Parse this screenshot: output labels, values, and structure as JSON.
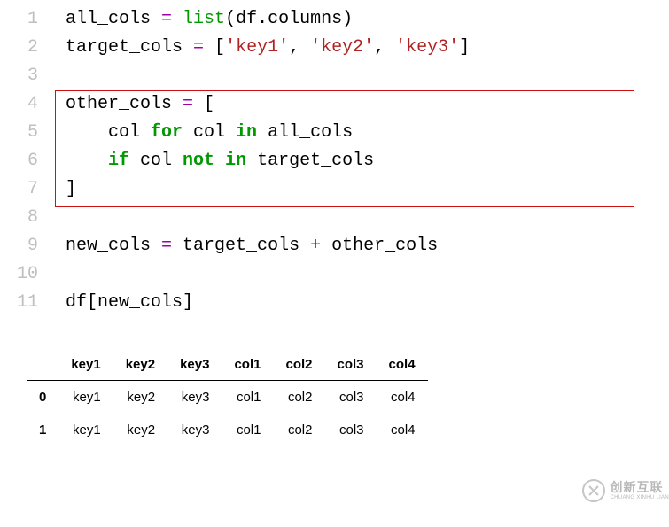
{
  "code": {
    "lines": [
      1,
      2,
      3,
      4,
      5,
      6,
      7,
      8,
      9,
      10,
      11
    ],
    "l1_v1": "all_cols ",
    "l1_eq": "= ",
    "l1_builtin": "list",
    "l1_rest1": "(df.columns)",
    "l2_v1": "target_cols ",
    "l2_eq": "= ",
    "l2_brkt1": "[",
    "l2_s1": "'key1'",
    "l2_c1": ", ",
    "l2_s2": "'key2'",
    "l2_c2": ", ",
    "l2_s3": "'key3'",
    "l2_brkt2": "]",
    "l3": "",
    "l4_v1": "other_cols ",
    "l4_eq": "= ",
    "l4_brkt": "[",
    "l5_pad": "    col ",
    "l5_for": "for",
    "l5_mid": " col ",
    "l5_in": "in",
    "l5_end": " all_cols",
    "l6_pad": "    ",
    "l6_if": "if",
    "l6_mid1": " col ",
    "l6_not": "not",
    "l6_mid2": " ",
    "l6_in": "in",
    "l6_end": " target_cols",
    "l7": "]",
    "l8": "",
    "l9_v1": "new_cols ",
    "l9_eq": "= ",
    "l9_mid": "target_cols ",
    "l9_plus": "+",
    "l9_end": " other_cols",
    "l10": "",
    "l11": "df[new_cols]"
  },
  "table": {
    "headers": [
      "key1",
      "key2",
      "key3",
      "col1",
      "col2",
      "col3",
      "col4"
    ],
    "rows": [
      {
        "idx": "0",
        "cells": [
          "key1",
          "key2",
          "key3",
          "col1",
          "col2",
          "col3",
          "col4"
        ]
      },
      {
        "idx": "1",
        "cells": [
          "key1",
          "key2",
          "key3",
          "col1",
          "col2",
          "col3",
          "col4"
        ]
      }
    ]
  },
  "watermark": {
    "cn": "创新互联",
    "en": "CHUANG XINHU LIAN"
  }
}
